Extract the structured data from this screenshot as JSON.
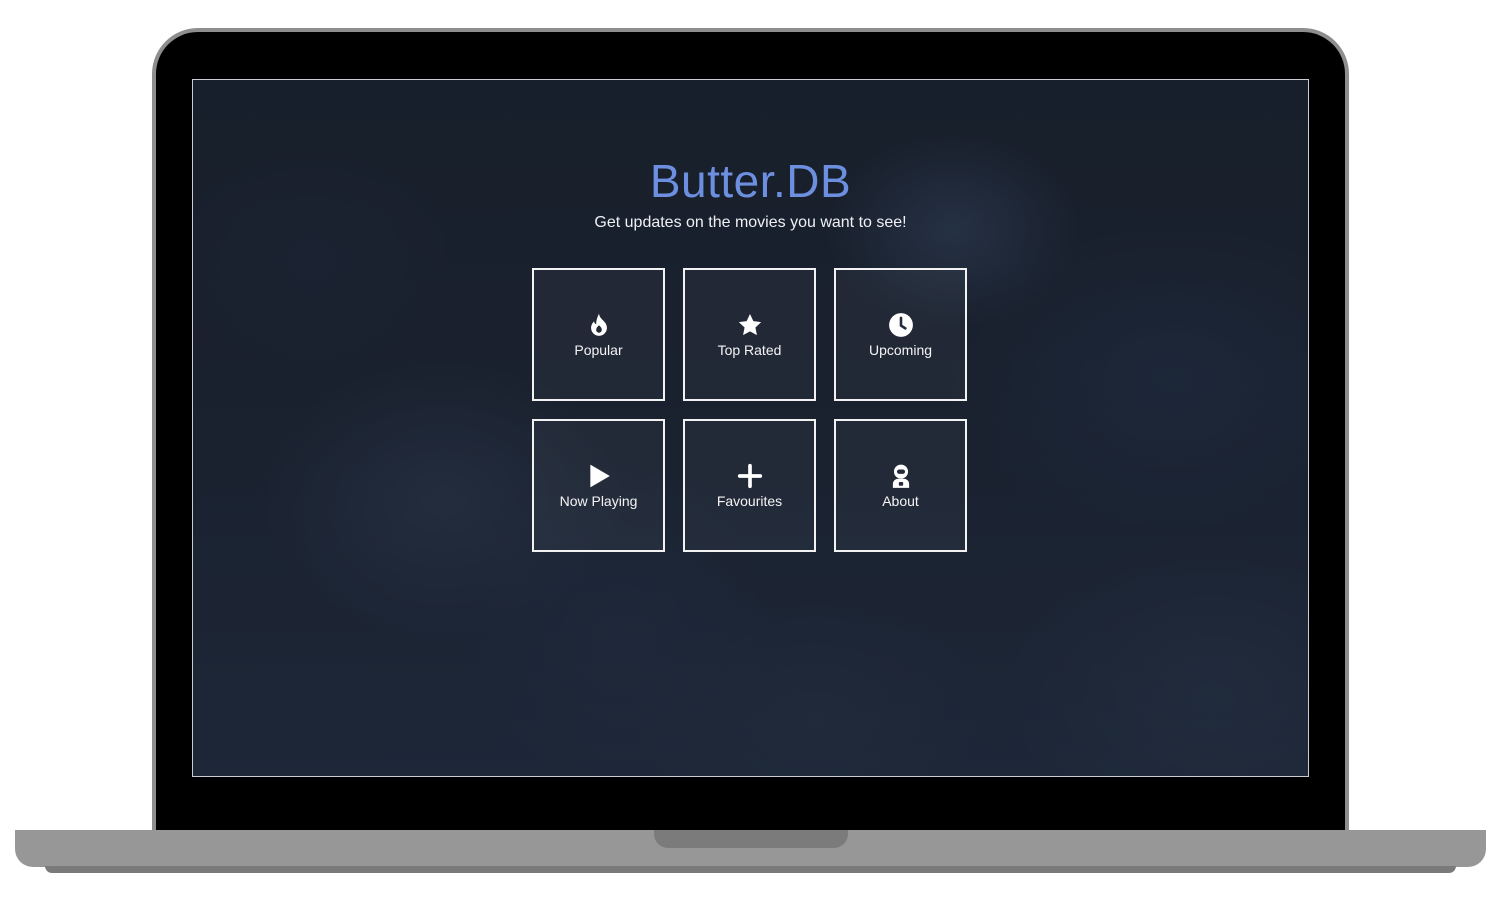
{
  "app": {
    "title": "Butter.DB",
    "subtitle": "Get updates on the movies you want to see!"
  },
  "colors": {
    "title": "#6d8fe0",
    "tile_border": "#f2f2f2",
    "background": "#1f2737",
    "device_frame": "#979797"
  },
  "tiles": [
    {
      "label": "Popular",
      "icon": "fire-icon"
    },
    {
      "label": "Top Rated",
      "icon": "star-icon"
    },
    {
      "label": "Upcoming",
      "icon": "clock-icon"
    },
    {
      "label": "Now Playing",
      "icon": "play-icon"
    },
    {
      "label": "Favourites",
      "icon": "plus-icon"
    },
    {
      "label": "About",
      "icon": "astronaut-icon"
    }
  ]
}
